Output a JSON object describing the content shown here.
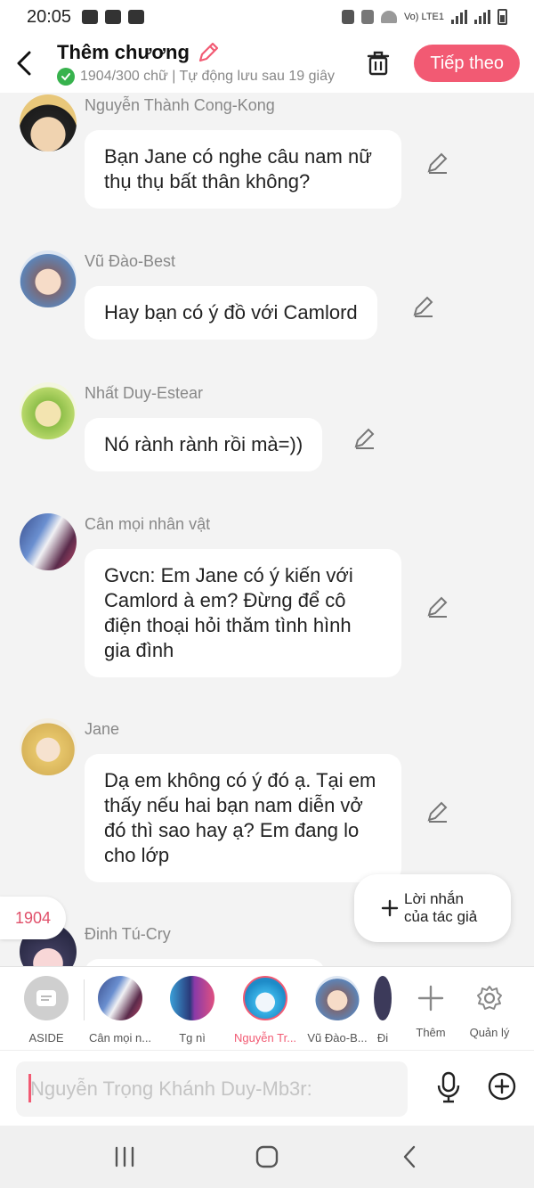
{
  "status_bar": {
    "time": "20:05",
    "network": "Vo) LTE1"
  },
  "header": {
    "title": "Thêm chương",
    "subtitle": "1904/300 chữ | Tự động lưu sau 19 giây",
    "next_label": "Tiếp theo"
  },
  "messages": [
    {
      "name": "Nguyễn Thành Cong-Kong",
      "text": "Bạn Jane có nghe câu nam nữ thụ thụ bất thân không?"
    },
    {
      "name": "Vũ Đào-Best",
      "text": "Hay bạn có ý đồ với Camlord"
    },
    {
      "name": "Nhất Duy-Estear",
      "text": "Nó rành rành rồi mà=))"
    },
    {
      "name": "Cân mọi nhân vật",
      "text": "Gvcn: Em Jane có ý kiến với Camlord à em? Đừng để cô điện thoại hỏi thăm tình hình gia đình"
    },
    {
      "name": "Jane",
      "text": "Dạ em không có ý đó ạ. Tại em thấy nếu hai bạn nam diễn vở đó thì sao hay ạ? Em đang lo cho lớp"
    },
    {
      "name": "Đinh Tú-Cry",
      "text": ""
    }
  ],
  "word_count_badge": "1904",
  "author_note": {
    "line1": "Lời nhắn",
    "line2": "của tác giả"
  },
  "characters": [
    {
      "label": "ASIDE"
    },
    {
      "label": "Cân mọi n..."
    },
    {
      "label": "Tg nì"
    },
    {
      "label": "Nguyễn Tr..."
    },
    {
      "label": "Vũ Đào-B..."
    },
    {
      "label": "Đi"
    },
    {
      "label": "Thêm"
    },
    {
      "label": "Quản lý"
    }
  ],
  "input": {
    "placeholder": "Nguyễn Trọng Khánh Duy-Mb3r:"
  },
  "colors": {
    "accent": "#f25a73",
    "check": "#37b24d",
    "background": "#f3f3f3"
  }
}
